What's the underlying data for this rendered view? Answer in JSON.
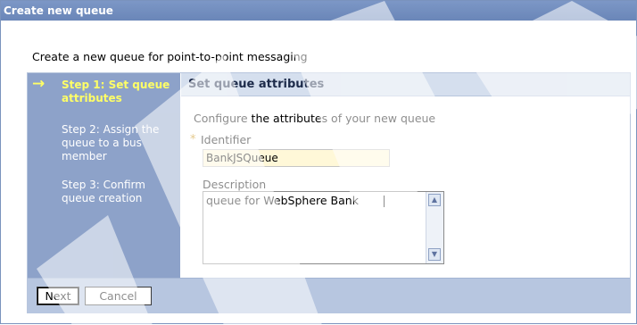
{
  "window": {
    "title": "Create new queue"
  },
  "intro": {
    "text": "Create a new queue for point-to-point messaging"
  },
  "steps": [
    {
      "label": "Step 1: Set queue attributes",
      "current": true
    },
    {
      "label": "Step 2: Assign the queue to a bus member",
      "current": false
    },
    {
      "label": "Step 3: Confirm queue creation",
      "current": false
    }
  ],
  "content": {
    "heading": "Set queue attributes",
    "description": "Configure the attributes of your new queue",
    "identifier": {
      "required_marker": "*",
      "label": "Identifier",
      "value": "BankJSQueue"
    },
    "description_field": {
      "label": "Description",
      "value": "queue for WebSphere Bank"
    }
  },
  "buttons": {
    "next": "Next",
    "cancel": "Cancel"
  },
  "colors": {
    "title_bar": "#6a86b8",
    "steps_panel": "#8da2c9",
    "current_step": "#ffff66",
    "content_header": "#d5dfee",
    "footer": "#b7c6e0",
    "identifier_field": "#fff8d8",
    "required_marker": "#c68a00"
  },
  "icons": {
    "current_step_arrow": "right-arrow-icon"
  }
}
